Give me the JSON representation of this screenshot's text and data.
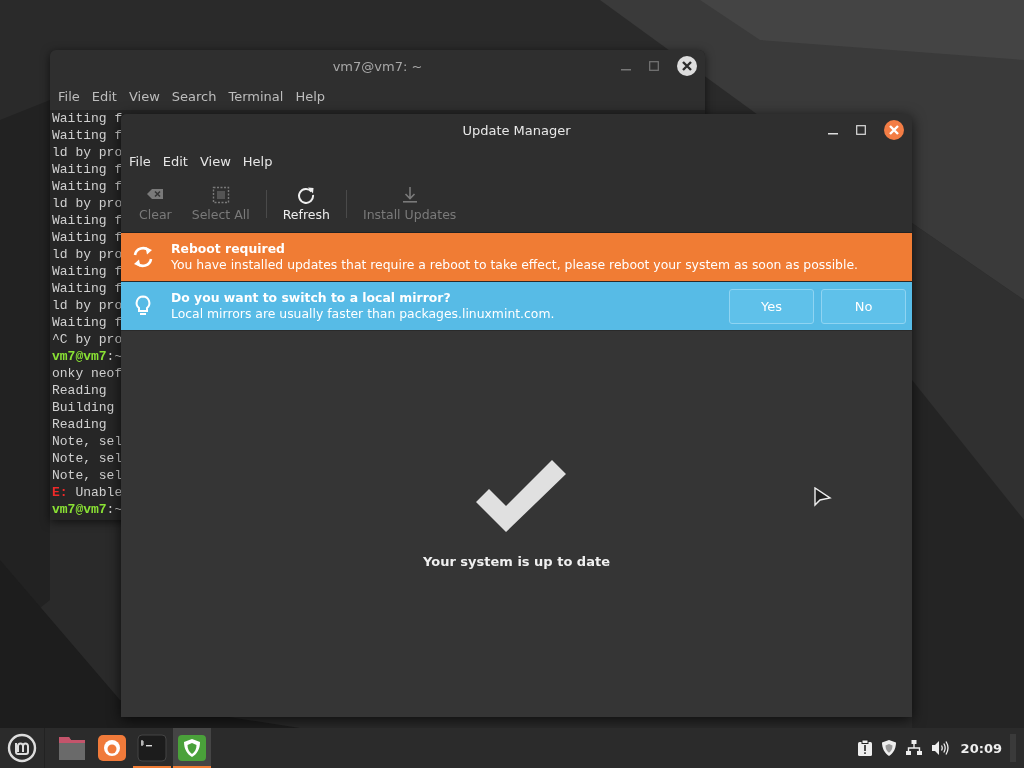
{
  "terminal_window": {
    "title": "vm7@vm7: ~",
    "menu": [
      "File",
      "Edit",
      "View",
      "Search",
      "Terminal",
      "Help"
    ],
    "lines": [
      {
        "kind": "text",
        "text": "Waiting f"
      },
      {
        "kind": "text",
        "text": "Waiting f"
      },
      {
        "kind": "text",
        "text": "ld by pro"
      },
      {
        "kind": "text",
        "text": "Waiting f"
      },
      {
        "kind": "text",
        "text": "Waiting f"
      },
      {
        "kind": "text",
        "text": "ld by pro"
      },
      {
        "kind": "text",
        "text": "Waiting f"
      },
      {
        "kind": "text",
        "text": "Waiting f"
      },
      {
        "kind": "text",
        "text": "ld by pro"
      },
      {
        "kind": "text",
        "text": "Waiting f"
      },
      {
        "kind": "text",
        "text": "Waiting f"
      },
      {
        "kind": "text",
        "text": "ld by pro"
      },
      {
        "kind": "text",
        "text": "Waiting f"
      },
      {
        "kind": "text",
        "text": "^C by pro"
      },
      {
        "kind": "prompt",
        "user": "vm7@vm7",
        "path": ":~"
      },
      {
        "kind": "text",
        "text": "onky neof"
      },
      {
        "kind": "text",
        "text": "Reading"
      },
      {
        "kind": "text",
        "text": "Building"
      },
      {
        "kind": "text",
        "text": "Reading"
      },
      {
        "kind": "text",
        "text": "Note, sel"
      },
      {
        "kind": "text",
        "text": "Note, sel"
      },
      {
        "kind": "text",
        "text": "Note, sel"
      },
      {
        "kind": "error",
        "prefix": "E:",
        "text": "Unable"
      },
      {
        "kind": "prompt",
        "user": "vm7@vm7",
        "path": ":~"
      }
    ]
  },
  "update_manager": {
    "title": "Update Manager",
    "menu": [
      "File",
      "Edit",
      "View",
      "Help"
    ],
    "toolbar": [
      {
        "kind": "button",
        "label": "Clear",
        "disabled": true
      },
      {
        "kind": "button",
        "label": "Select All",
        "disabled": true
      },
      {
        "kind": "separator"
      },
      {
        "kind": "button",
        "label": "Refresh",
        "disabled": false
      },
      {
        "kind": "separator"
      },
      {
        "kind": "button",
        "label": "Install Updates",
        "disabled": true
      }
    ],
    "infobars": [
      {
        "kind": "warning",
        "title": "Reboot required",
        "message": "You have installed updates that require a reboot to take effect, please reboot your system as soon as possible."
      },
      {
        "kind": "info",
        "title": "Do you want to switch to a local mirror?",
        "message": "Local mirrors are usually faster than packages.linuxmint.com.",
        "buttons": [
          "Yes",
          "No"
        ]
      }
    ],
    "status": "Your system is up to date"
  },
  "taskbar": {
    "apps": [
      {
        "running": false,
        "active": false
      },
      {
        "running": false,
        "active": false
      },
      {
        "running": true,
        "active": false
      },
      {
        "running": true,
        "active": true
      }
    ],
    "clock": "20:09"
  }
}
